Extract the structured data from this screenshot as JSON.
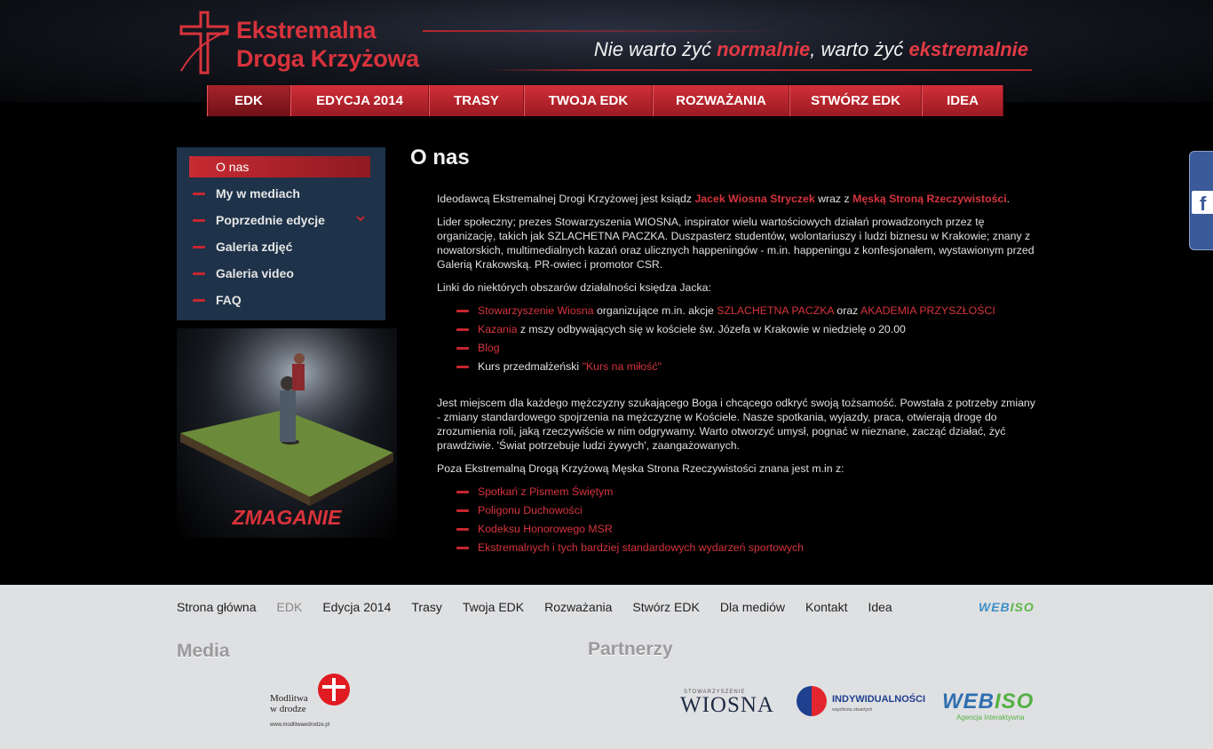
{
  "header": {
    "logo_line1": "Ekstremalna",
    "logo_line2": "Droga Krzyżowa",
    "tagline_a": "Nie warto żyć ",
    "tagline_b": "normalnie",
    "tagline_c": ", warto żyć ",
    "tagline_d": "ekstremalnie"
  },
  "nav": [
    "EDK",
    "EDYCJA 2014",
    "TRASY",
    "TWOJA EDK",
    "ROZWAŻANIA",
    "STWÓRZ EDK",
    "IDEA"
  ],
  "sidebar": {
    "items": [
      "O nas",
      "My w mediach",
      "Poprzednie edycje",
      "Galeria zdjęć",
      "Galeria video",
      "FAQ"
    ],
    "promo_title": "ZMAGANIE"
  },
  "content": {
    "title": "O nas",
    "p1_a": "Ideodawcą Ekstremalnej Drogi Krzyżowej jest ksiądz ",
    "p1_link1": "Jacek Wiosna Stryczek",
    "p1_b": " wraz z ",
    "p1_link2": "Męską Stroną Rzeczywistości",
    "p1_c": ".",
    "p2": "Lider społeczny; prezes Stowarzyszenia WIOSNA, inspirator wielu wartościowych działań prowadzonych przez tę organizację, takich jak SZLACHETNA PACZKA. Duszpasterz studentów, wolontariuszy i ludzi biznesu w Krakowie; znany z nowatorskich, multimedialnych kazań oraz ulicznych happeningów - m.in. happeningu z konfesjonałem, wystawionym przed Galerią Krakowską. PR-owiec i promotor CSR.",
    "p3": "Linki do niektórych obszarów działalności księdza Jacka:",
    "list1": {
      "i1_link": "Stowarzyszenie Wiosna",
      "i1_text": " organizujące m.in. akcje ",
      "i1_link2": "SZLACHETNA PACZKA",
      "i1_text2": " oraz ",
      "i1_link3": "AKADEMIA PRZYSZŁOŚCI",
      "i2_link": "Kazania",
      "i2_text": " z mszy odbywających się w kościele św. Józefa w Krakowie w niedzielę o 20.00",
      "i3_link": "Blog",
      "i4_text": "Kurs przedmałżeński ",
      "i4_link": "\"Kurs na miłość\""
    },
    "p4": "Jest miejscem dla każdego mężczyzny szukającego Boga i chcącego odkryć swoją tożsamość. Powstała z potrzeby zmiany - zmiany standardowego spojrzenia na mężczyznę w Kościele. Nasze spotkania, wyjazdy, praca, otwierają drogę do zrozumienia roli, jaką rzeczywiście w nim odgrywamy. Warto otworzyć umysł, pognać w nieznane, zacząć działać, żyć prawdziwie. 'Świat potrzebuje ludzi żywych', zaangażowanych.",
    "p5": "Poza Ekstremalną Drogą Krzyżową Męska Strona Rzeczywistości znana jest m.in z:",
    "list2": [
      "Spotkań z Pismem Świętym",
      "Poligonu Duchowości",
      "Kodeksu Honorowego MSR",
      "Ekstremalnych i tych bardziej standardowych wydarzeń sportowych"
    ]
  },
  "footer": {
    "nav": [
      "Strona główna",
      "EDK",
      "Edycja 2014",
      "Trasy",
      "Twoja EDK",
      "Rozważania",
      "Stwórz EDK",
      "Dla mediów",
      "Kontakt",
      "Idea"
    ],
    "media_title": "Media",
    "partners_title": "Partnerzy",
    "mwd_line1": "Modlitwa",
    "mwd_line2": "w drodze",
    "mwd_url": "www.modlitwawdrodze.pl",
    "wiosna_small": "STOWARZYSZENIE",
    "wiosna_big": "WIOSNA",
    "indyw": "INDYWIDUALNOŚCI",
    "indyw_sub": "wspólnota otwartych",
    "webiso_a": "WEB",
    "webiso_b": "ISO",
    "webiso_sub": "Agencja Interaktywna"
  },
  "colors": {
    "accent": "#d6343d",
    "sidebar": "#1e3249",
    "footer": "#dfe0e2",
    "facebook": "#3a5a99"
  }
}
